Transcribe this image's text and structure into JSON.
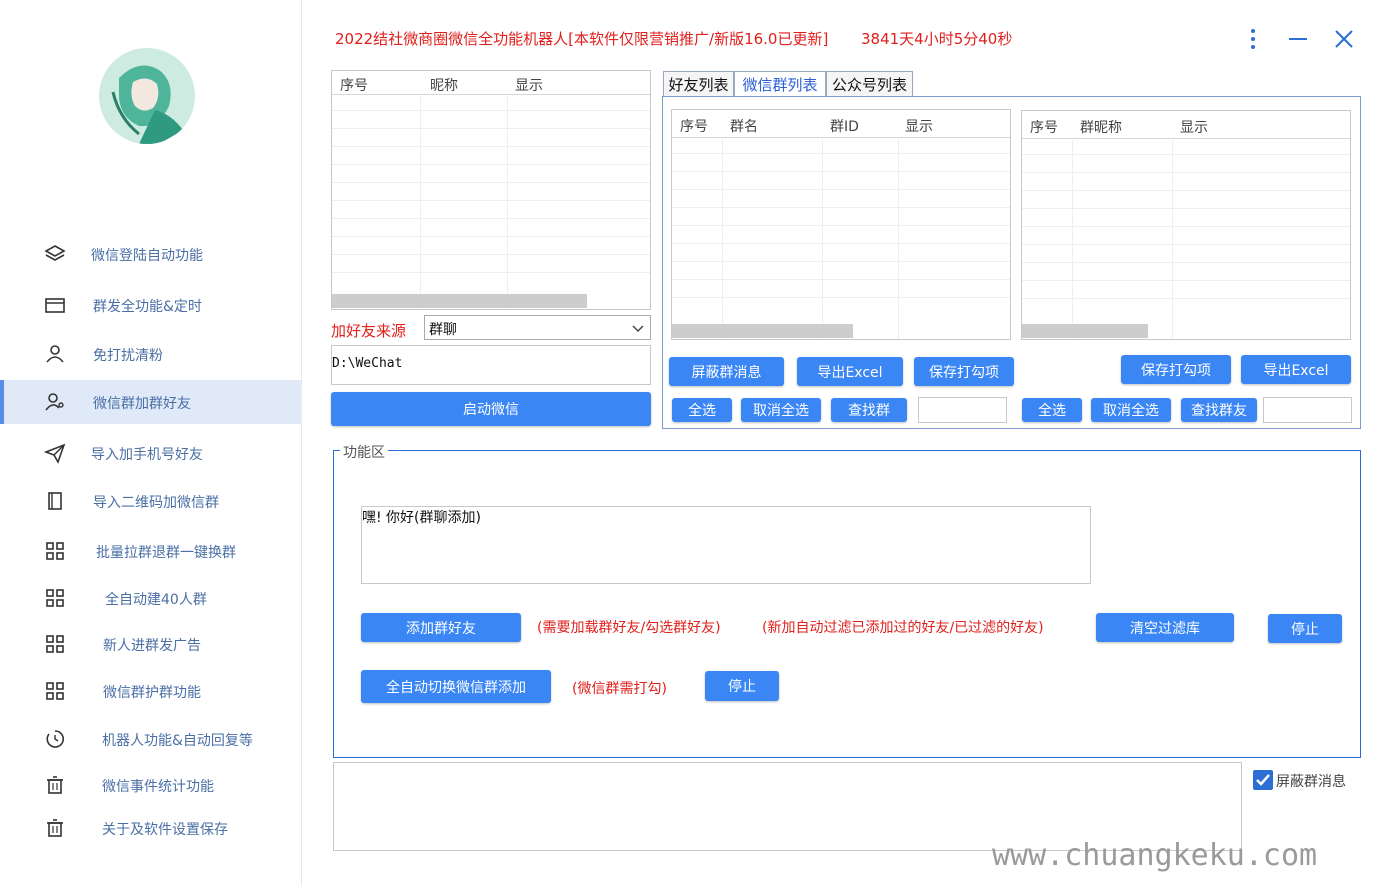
{
  "header": {
    "title": "2022结社微商圈微信全功能机器人[本软件仅限营销推广/新版16.0已更新]",
    "timer": "3841天4小时5分40秒"
  },
  "sidebar": {
    "items": [
      {
        "label": "微信登陆自动功能",
        "icon": "layers-icon"
      },
      {
        "label": "群发全功能&定时",
        "icon": "folder-icon"
      },
      {
        "label": "免打扰清粉",
        "icon": "user-icon"
      },
      {
        "label": "微信群加群好友",
        "icon": "user-group-icon"
      },
      {
        "label": "导入加手机号好友",
        "icon": "send-icon"
      },
      {
        "label": "导入二维码加微信群",
        "icon": "book-icon"
      },
      {
        "label": "批量拉群退群一键换群",
        "icon": "grid-icon"
      },
      {
        "label": "全自动建40人群",
        "icon": "grid-icon"
      },
      {
        "label": "新人进群发广告",
        "icon": "grid-icon"
      },
      {
        "label": "微信群护群功能",
        "icon": "grid-icon"
      },
      {
        "label": "机器人功能&自动回复等",
        "icon": "clock-icon"
      },
      {
        "label": "微信事件统计功能",
        "icon": "trash-icon"
      },
      {
        "label": "关于及软件设置保存",
        "icon": "trash-icon"
      }
    ],
    "active_index": 3
  },
  "left_table": {
    "columns": [
      "序号",
      "昵称",
      "显示"
    ]
  },
  "source": {
    "label": "加好友来源",
    "selected": "群聊",
    "path": "D:\\WeChat",
    "start_button": "启动微信"
  },
  "tabs": [
    "好友列表",
    "微信群列表",
    "公众号列表"
  ],
  "active_tab": 1,
  "group_table": {
    "columns": [
      "序号",
      "群名",
      "群ID",
      "显示"
    ],
    "buttons": [
      "屏蔽群消息",
      "导出Excel",
      "保存打勾项"
    ],
    "select_all": "全选",
    "deselect_all": "取消全选",
    "search": "查找群"
  },
  "member_table": {
    "columns": [
      "序号",
      "群昵称",
      "显示"
    ],
    "buttons": [
      "保存打勾项",
      "导出Excel"
    ],
    "select_all": "全选",
    "deselect_all": "取消全选",
    "search": "查找群友"
  },
  "function_area": {
    "legend": "功能区",
    "message": "嘿! 你好(群聊添加)",
    "add_button": "添加群好友",
    "note1": "(需要加载群好友/勾选群好友)",
    "note2": "(新加自动过滤已添加过的好友/已过滤的好友)",
    "clear_button": "清空过滤库",
    "stop_button": "停止",
    "auto_button": "全自动切换微信群添加",
    "note3": "(微信群需打勾)",
    "stop2_button": "停止"
  },
  "log": {
    "block_checkbox_label": "屏蔽群消息",
    "block_checked": true
  },
  "watermark": "www.chuangkeku.com",
  "colors": {
    "accent": "#3a86f5",
    "title_red": "#e0201c",
    "sidebar_text": "#4a6fa5",
    "active_bg": "#dfe9f8"
  }
}
